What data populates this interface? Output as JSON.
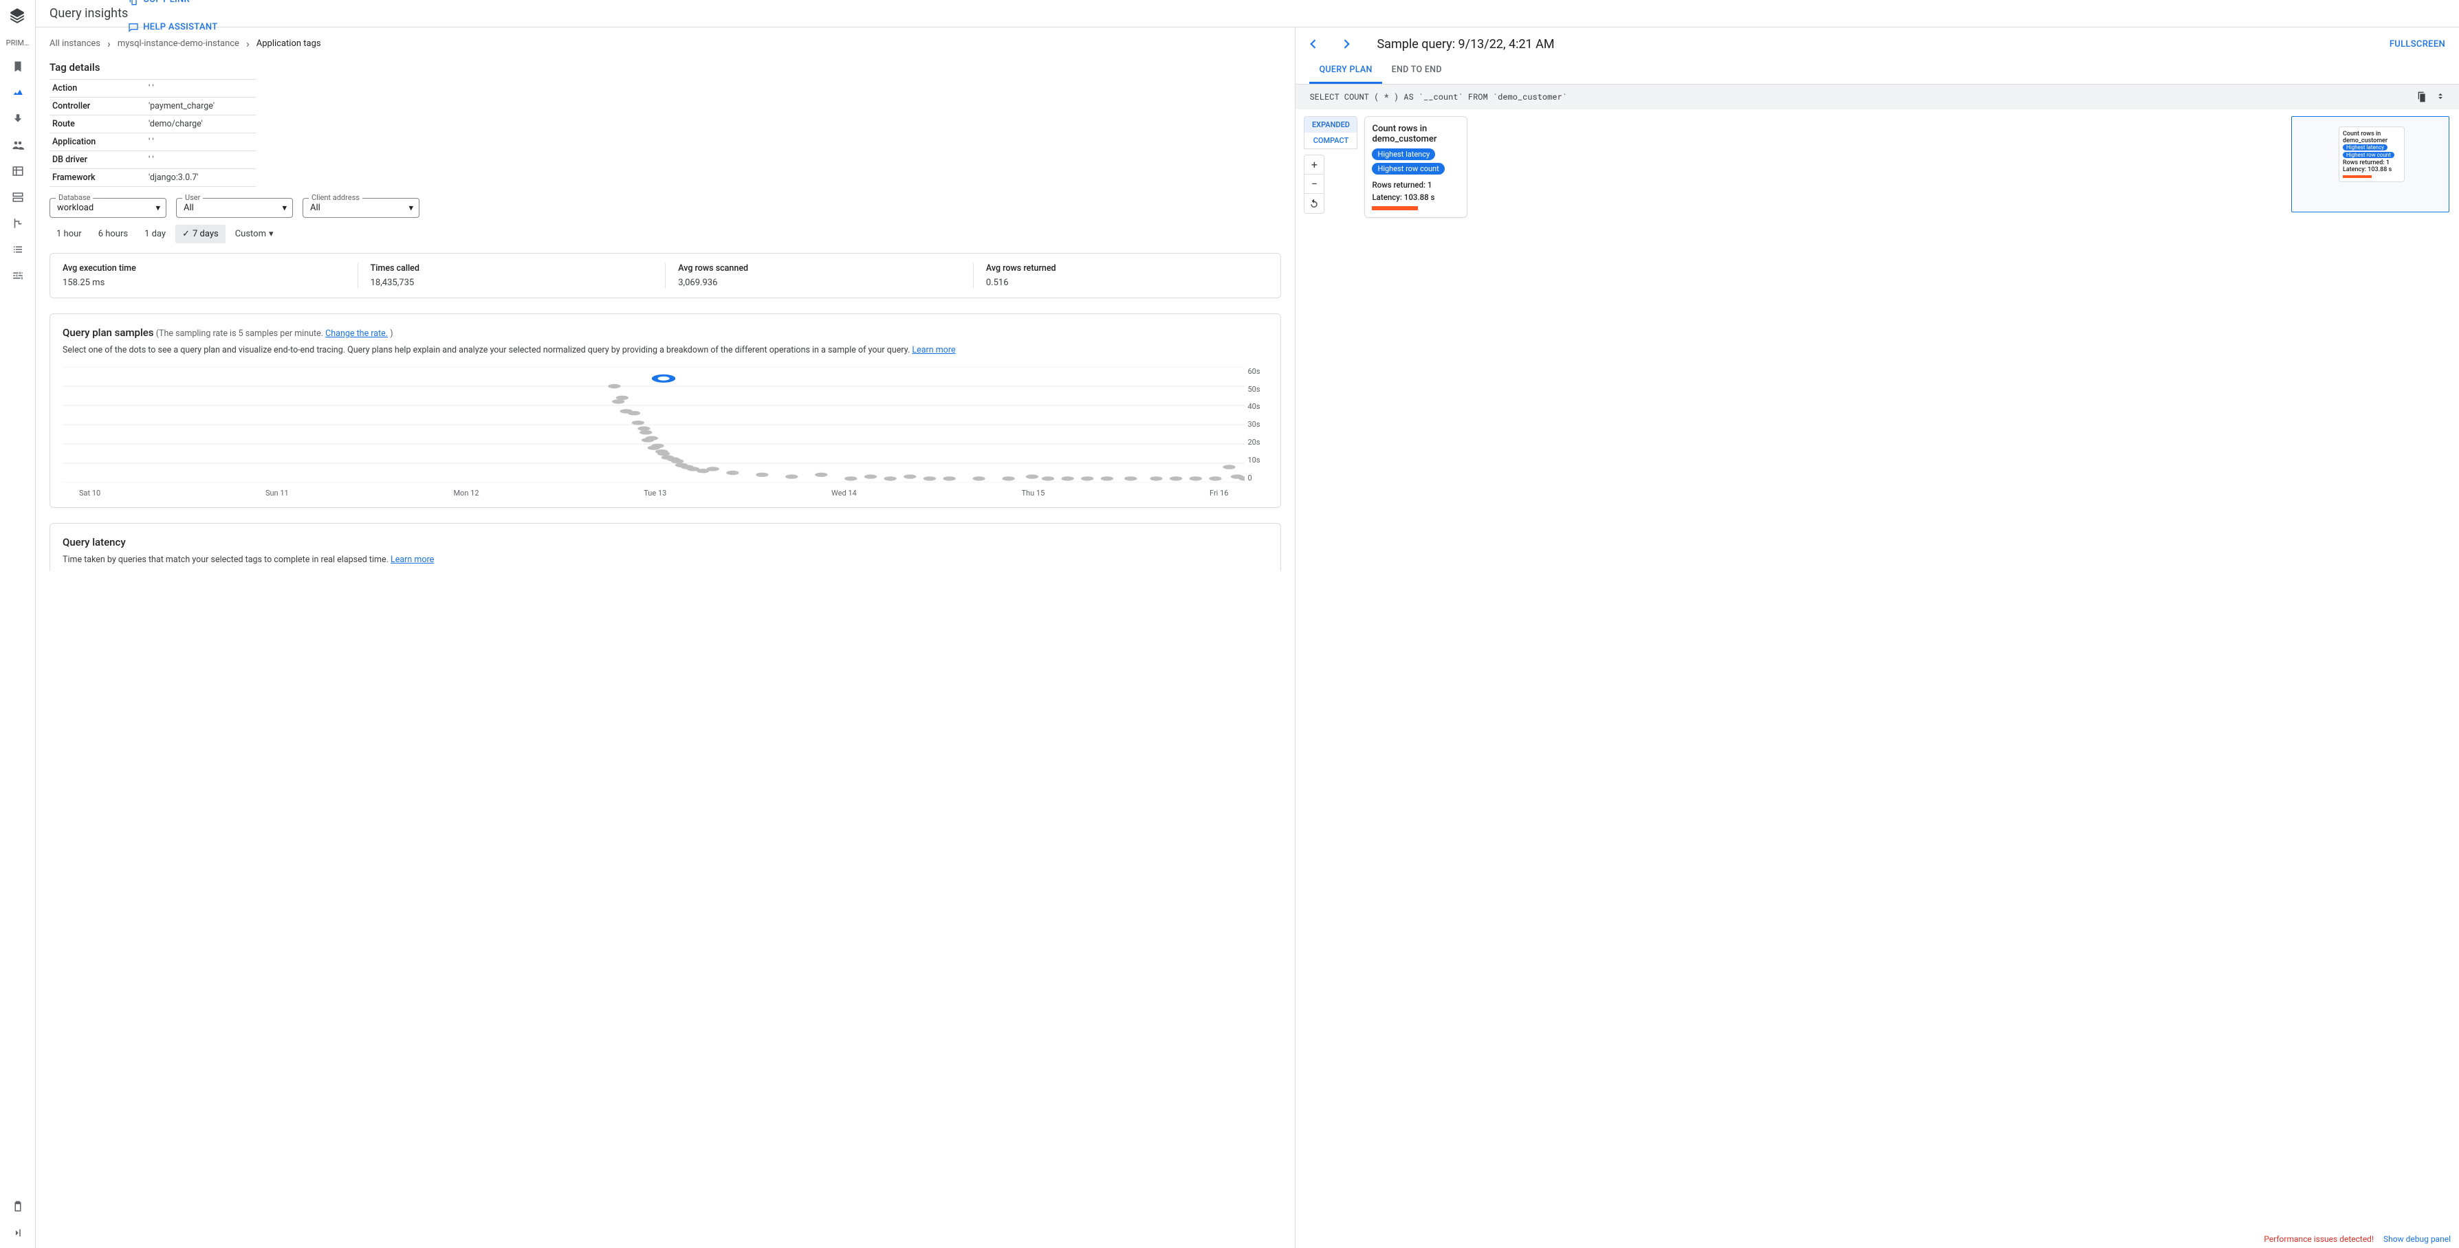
{
  "navrail": {
    "primary_label": "PRIM…"
  },
  "topbar": {
    "title": "Query insights",
    "copy_link": "COPY LINK",
    "help": "HELP ASSISTANT"
  },
  "breadcrumbs": {
    "items": [
      "All instances",
      "mysql-instance-demo-instance",
      "Application tags"
    ]
  },
  "tag_details": {
    "heading": "Tag details",
    "rows": [
      {
        "k": "Action",
        "v": "' '"
      },
      {
        "k": "Controller",
        "v": "'payment_charge'"
      },
      {
        "k": "Route",
        "v": "'demo/charge'"
      },
      {
        "k": "Application",
        "v": "' '"
      },
      {
        "k": "DB driver",
        "v": "' '"
      },
      {
        "k": "Framework",
        "v": "'django:3.0.7'"
      }
    ]
  },
  "filters": {
    "database": {
      "label": "Database",
      "value": "workload"
    },
    "user": {
      "label": "User",
      "value": "All"
    },
    "client": {
      "label": "Client address",
      "value": "All"
    }
  },
  "timerange": {
    "opts": [
      "1 hour",
      "6 hours",
      "1 day",
      "7 days",
      "Custom"
    ],
    "active": "7 days"
  },
  "stats": [
    {
      "label": "Avg execution time",
      "value": "158.25 ms"
    },
    {
      "label": "Times called",
      "value": "18,435,735"
    },
    {
      "label": "Avg rows scanned",
      "value": "3,069.936"
    },
    {
      "label": "Avg rows returned",
      "value": "0.516"
    }
  ],
  "samples_panel": {
    "title": "Query plan samples",
    "subtitle_prefix": "(The sampling rate is 5 samples per minute. ",
    "subtitle_link": "Change the rate.",
    "subtitle_suffix": " )",
    "desc": "Select one of the dots to see a query plan and visualize end-to-end tracing. Query plans help explain and analyze your selected normalized query by providing a breakdown of the different operations in a sample of your query. ",
    "learn_more": "Learn more"
  },
  "chart_data": {
    "type": "scatter",
    "ylabel_unit": "s",
    "ylim": [
      0,
      60
    ],
    "y_ticks": [
      0,
      10,
      20,
      30,
      40,
      50,
      60
    ],
    "x_categories": [
      "Sat 10",
      "Sun 11",
      "Mon 12",
      "Tue 13",
      "Wed 14",
      "Thu 15",
      "Fri 16"
    ],
    "points": [
      {
        "x": 2.8,
        "y": 50
      },
      {
        "x": 2.82,
        "y": 42
      },
      {
        "x": 2.84,
        "y": 44
      },
      {
        "x": 2.86,
        "y": 37
      },
      {
        "x": 2.9,
        "y": 36
      },
      {
        "x": 2.92,
        "y": 31
      },
      {
        "x": 2.95,
        "y": 28
      },
      {
        "x": 2.96,
        "y": 26
      },
      {
        "x": 2.97,
        "y": 22
      },
      {
        "x": 2.99,
        "y": 23
      },
      {
        "x": 3.0,
        "y": 18
      },
      {
        "x": 3.02,
        "y": 19
      },
      {
        "x": 3.04,
        "y": 16
      },
      {
        "x": 3.05,
        "y": 15
      },
      {
        "x": 3.07,
        "y": 13
      },
      {
        "x": 3.1,
        "y": 12
      },
      {
        "x": 3.12,
        "y": 11
      },
      {
        "x": 3.14,
        "y": 9
      },
      {
        "x": 3.17,
        "y": 8
      },
      {
        "x": 3.2,
        "y": 7
      },
      {
        "x": 3.25,
        "y": 6
      },
      {
        "x": 3.3,
        "y": 7
      },
      {
        "x": 3.4,
        "y": 5
      },
      {
        "x": 3.55,
        "y": 4
      },
      {
        "x": 3.7,
        "y": 3
      },
      {
        "x": 3.85,
        "y": 4
      },
      {
        "x": 4.0,
        "y": 2
      },
      {
        "x": 4.1,
        "y": 3
      },
      {
        "x": 4.2,
        "y": 2
      },
      {
        "x": 4.3,
        "y": 3
      },
      {
        "x": 4.4,
        "y": 2
      },
      {
        "x": 4.5,
        "y": 2
      },
      {
        "x": 4.65,
        "y": 2
      },
      {
        "x": 4.8,
        "y": 2
      },
      {
        "x": 4.92,
        "y": 3
      },
      {
        "x": 5.0,
        "y": 2
      },
      {
        "x": 5.1,
        "y": 2
      },
      {
        "x": 5.2,
        "y": 2
      },
      {
        "x": 5.3,
        "y": 2
      },
      {
        "x": 5.42,
        "y": 2
      },
      {
        "x": 5.55,
        "y": 2
      },
      {
        "x": 5.65,
        "y": 2
      },
      {
        "x": 5.75,
        "y": 2
      },
      {
        "x": 5.85,
        "y": 2
      },
      {
        "x": 5.92,
        "y": 8
      },
      {
        "x": 5.96,
        "y": 3
      },
      {
        "x": 6.0,
        "y": 2
      }
    ],
    "selected_point": {
      "x": 3.05,
      "y": 54
    }
  },
  "latency_panel": {
    "title": "Query latency",
    "desc": "Time taken by queries that match your selected tags to complete in real elapsed time. ",
    "learn_more": "Learn more"
  },
  "sample": {
    "nav_prev": "‹",
    "nav_next": "›",
    "title": "Sample query: 9/13/22, 4:21 AM",
    "fullscreen": "FULLSCREEN",
    "tabs": {
      "plan": "QUERY PLAN",
      "e2e": "END TO END"
    },
    "sql": "SELECT COUNT ( * ) AS `__count` FROM `demo_customer`"
  },
  "plan": {
    "view_expanded": "EXPANDED",
    "view_compact": "COMPACT",
    "node": {
      "title": "Count rows in demo_customer",
      "badge1": "Highest latency",
      "badge2": "Highest row count",
      "rows": "Rows returned: 1",
      "latency": "Latency: 103.88 s"
    }
  },
  "footer": {
    "warn": "Performance issues detected!",
    "debug": "Show debug panel"
  }
}
